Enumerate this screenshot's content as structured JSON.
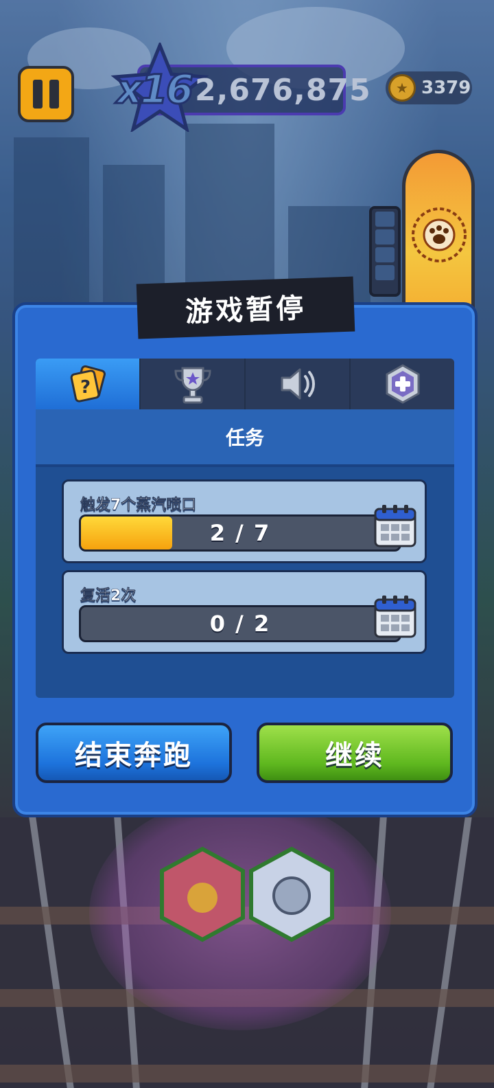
{
  "hud": {
    "score_multiplier": "x16",
    "score": "2,676,875",
    "coins": "3379"
  },
  "pause_menu": {
    "title": "游戏暂停",
    "tabs": [
      {
        "name": "missions",
        "icon": "mission-cards-icon",
        "active": true
      },
      {
        "name": "achievements",
        "icon": "trophy-icon",
        "active": false
      },
      {
        "name": "sound",
        "icon": "speaker-icon",
        "active": false
      },
      {
        "name": "boosts",
        "icon": "plus-hexagon-icon",
        "active": false
      }
    ],
    "section_title": "任务",
    "missions": [
      {
        "label": "触发7个蒸汽喷口",
        "progress_text": "2 / 7",
        "progress": 2,
        "total": 7,
        "icon": "calendar-icon"
      },
      {
        "label": "复活2次",
        "progress_text": "0 / 2",
        "progress": 0,
        "total": 2,
        "icon": "calendar-icon"
      }
    ],
    "buttons": {
      "end_run": "结束奔跑",
      "continue": "继续"
    }
  },
  "colors": {
    "panel": "#2a6ad0",
    "end_button": "#1d73dc",
    "continue_button": "#5fb81f",
    "progress_fill": "#f6a20e"
  }
}
